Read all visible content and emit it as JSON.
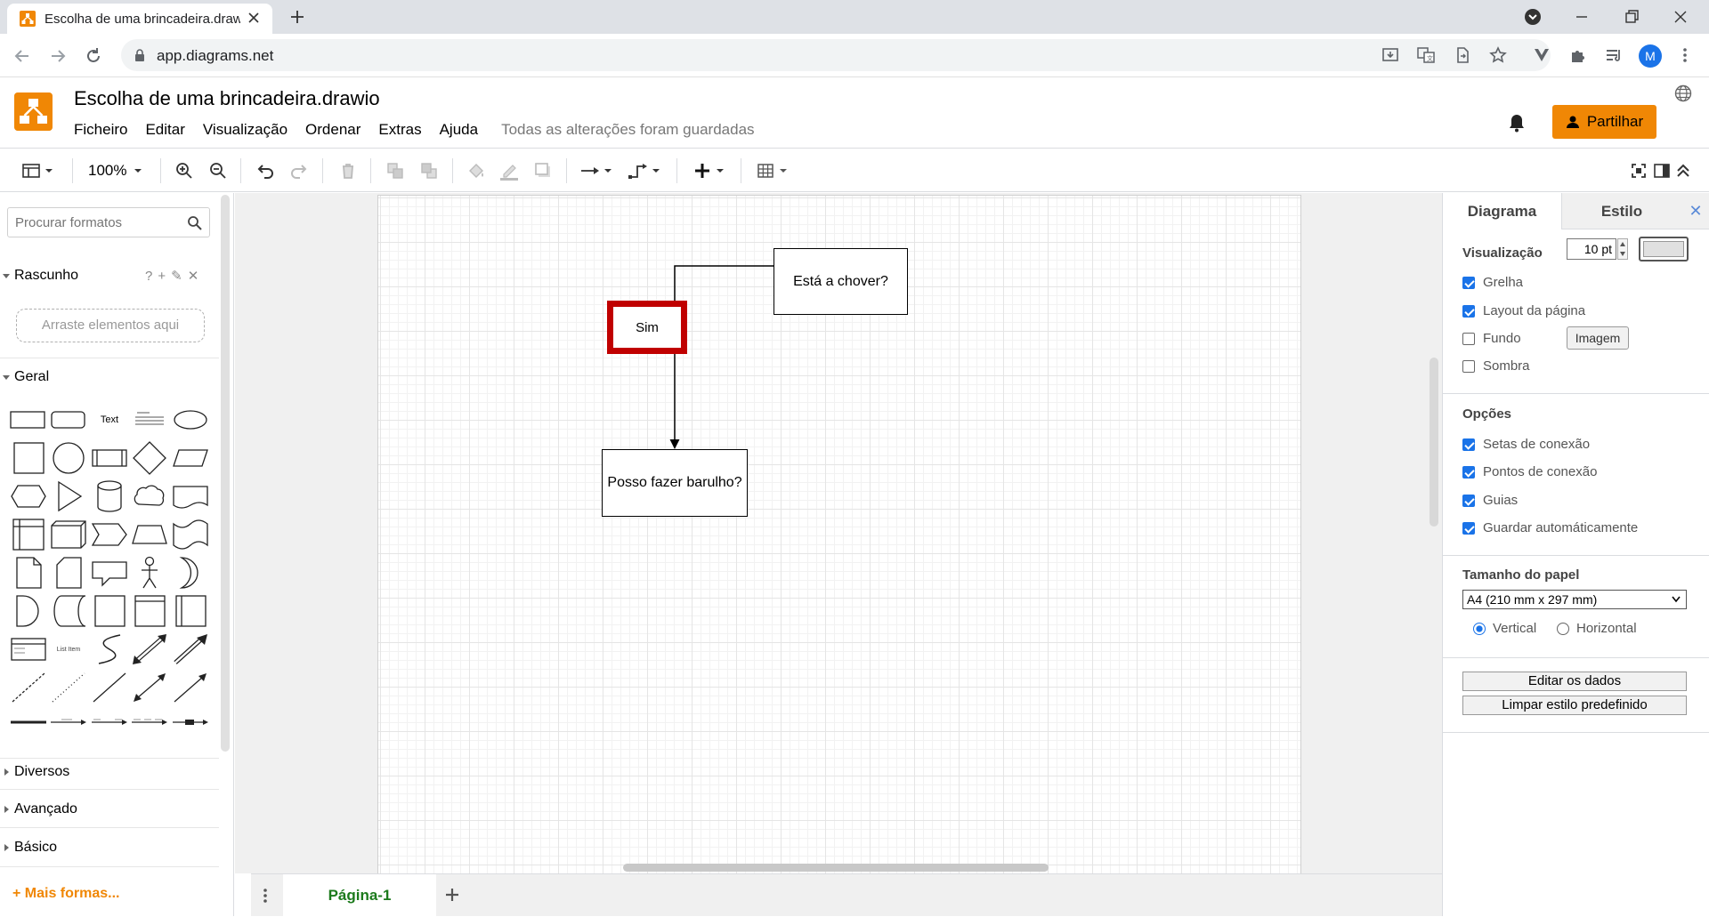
{
  "browser": {
    "tab_title": "Escolha de uma brincadeira.draw",
    "url": "app.diagrams.net",
    "profile_initial": "M"
  },
  "app": {
    "doc_title": "Escolha de uma brincadeira.drawio",
    "menu": [
      "Ficheiro",
      "Editar",
      "Visualização",
      "Ordenar",
      "Extras",
      "Ajuda"
    ],
    "save_status": "Todas as alterações foram guardadas",
    "share_label": "Partilhar",
    "accent_color": "#f08705"
  },
  "toolbar": {
    "zoom": "100%"
  },
  "sidebar": {
    "search_placeholder": "Procurar formatos",
    "scratch_title": "Rascunho",
    "scratch_tools": [
      "?",
      "+",
      "✎",
      "✕"
    ],
    "dropzone": "Arraste elementos aqui",
    "general_title": "Geral",
    "shape_text": "Text",
    "shape_list_item": "List Item",
    "collapsed_sections": [
      "Diversos",
      "Avançado",
      "Básico"
    ],
    "more_shapes": "+ Mais formas..."
  },
  "diagram": {
    "nodes": {
      "rain": "Está a chover?",
      "yes": "Sim",
      "noise": "Posso fazer barulho?"
    },
    "highlight_color": "#c00000"
  },
  "pages": {
    "tabs": [
      "Página-1"
    ]
  },
  "format_panel": {
    "tab_diagram": "Diagrama",
    "tab_style": "Estilo",
    "close_symbol": "✕",
    "view_title": "Visualização",
    "grid_label": "Grelha",
    "grid_size": "10 pt",
    "page_layout_label": "Layout da página",
    "background_label": "Fundo",
    "image_button": "Imagem",
    "shadow_label": "Sombra",
    "options_title": "Opções",
    "options": [
      "Setas de conexão",
      "Pontos de conexão",
      "Guias",
      "Guardar automáticamente"
    ],
    "paper_title": "Tamanho do papel",
    "paper_value": "A4 (210 mm x 297 mm)",
    "orientation_vertical": "Vertical",
    "orientation_horizontal": "Horizontal",
    "edit_data_button": "Editar os dados",
    "clear_style_button": "Limpar estilo predefinido"
  }
}
